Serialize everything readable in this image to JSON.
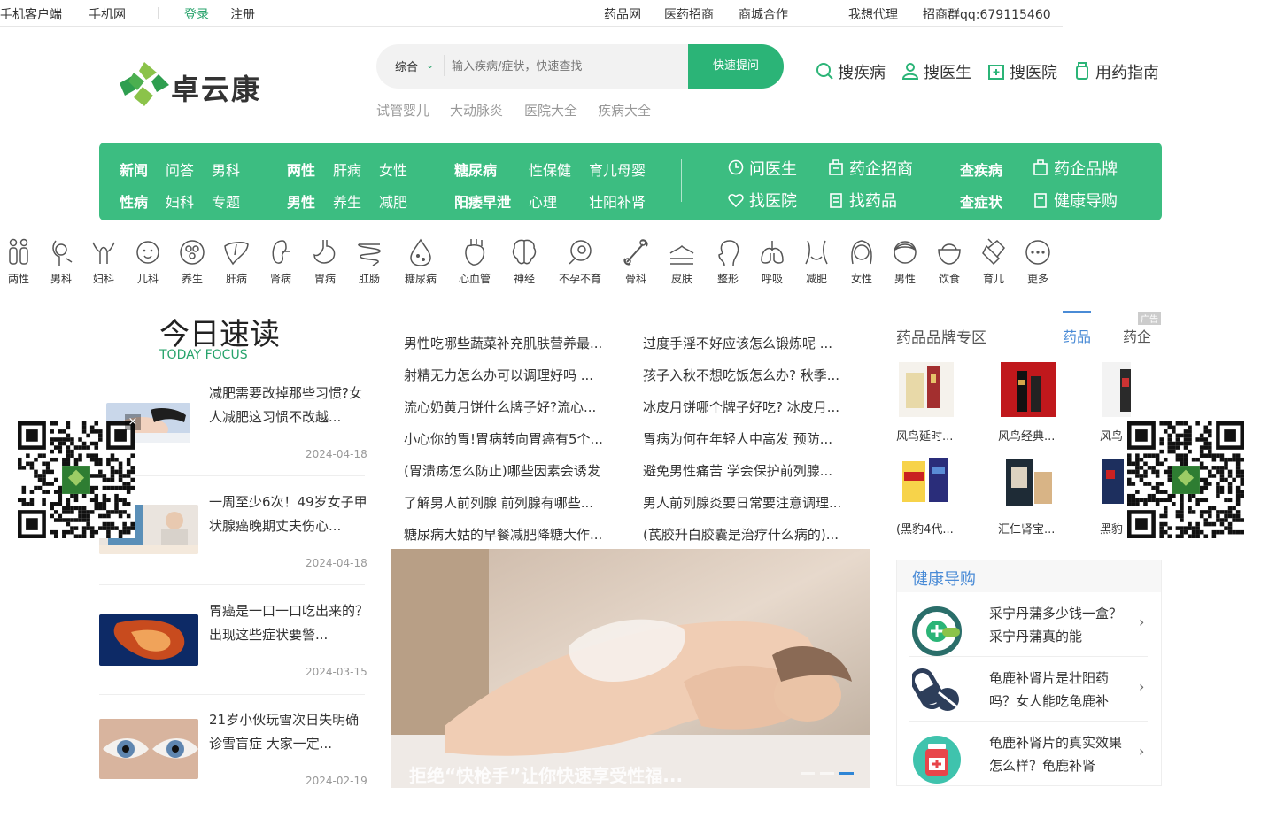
{
  "topbar": {
    "left": [
      "手机客户端",
      "手机网"
    ],
    "login": "登录",
    "register": "注册",
    "right": [
      "药品网",
      "医药招商",
      "商城合作"
    ],
    "agent": "我想代理",
    "qq": "招商群qq:679115460"
  },
  "logo": {
    "text": "卓云康",
    "colors": [
      "#8bc34a",
      "#2e9e4f"
    ]
  },
  "search": {
    "category": "综合",
    "placeholder": "输入疾病/症状，快速查找",
    "button": "快速提问",
    "hot": [
      "试管婴儿",
      "大动脉炎",
      "医院大全",
      "疾病大全"
    ]
  },
  "quick_links": [
    {
      "label": "搜疾病",
      "icon": "search-icon"
    },
    {
      "label": "搜医生",
      "icon": "user-icon"
    },
    {
      "label": "搜医院",
      "icon": "hospital-icon"
    },
    {
      "label": "用药指南",
      "icon": "medicine-bottle-icon"
    }
  ],
  "nav": {
    "row1": [
      "新闻",
      "问答",
      "男科",
      "两性",
      "肝病",
      "女性",
      "糖尿病",
      "性保健",
      "育儿母婴"
    ],
    "row2": [
      "性病",
      "妇科",
      "专题",
      "男性",
      "养生",
      "减肥",
      "阳痿早泄",
      "心理",
      "壮阳补肾"
    ],
    "services1": [
      "问医生",
      "药企招商"
    ],
    "services2": [
      "找医院",
      "找药品"
    ],
    "right1": [
      "查疾病",
      "药企品牌"
    ],
    "right2": [
      "查症状",
      "健康导购"
    ],
    "bg": "#3cbd81"
  },
  "categories": [
    "两性",
    "男科",
    "妇科",
    "儿科",
    "养生",
    "肝病",
    "肾病",
    "胃病",
    "肛肠",
    "糖尿病",
    "心血管",
    "神经",
    "不孕不育",
    "骨科",
    "皮肤",
    "整形",
    "呼吸",
    "减肥",
    "女性",
    "男性",
    "饮食",
    "育儿",
    "更多"
  ],
  "today": {
    "title": "今日速读",
    "subtitle": "TODAY FOCUS",
    "news": [
      {
        "title": "减肥需要改掉那些习惯?女人减肥这习惯不改越...",
        "date": "2024-04-18"
      },
      {
        "title": "一周至少6次！49岁女子甲状腺癌晚期丈夫伤心...",
        "date": "2024-04-18"
      },
      {
        "title": "胃癌是一口一口吃出来的？出现这些症状要警...",
        "date": "2024-03-15"
      },
      {
        "title": "21岁小伙玩雪次日失明确诊雪盲症 大家一定...",
        "date": "2024-02-19"
      }
    ]
  },
  "links": {
    "col1": [
      "男性吃哪些蔬菜补充肌肤营养最...",
      "射精无力怎么办可以调理好吗 ...",
      "流心奶黄月饼什么牌子好?流心...",
      "小心你的胃!胃病转向胃癌有5个...",
      "(胃溃疡怎么防止)哪些因素会诱发",
      "了解男人前列腺 前列腺有哪些...",
      "糖尿病大姑的早餐减肥降糖大作..."
    ],
    "col2": [
      "过度手淫不好应该怎么锻炼呢 ...",
      "孩子入秋不想吃饭怎么办? 秋季...",
      "冰皮月饼哪个牌子好吃? 冰皮月...",
      "胃病为何在年轻人中高发 预防...",
      "避免男性痛苦 学会保护前列腺...",
      "男人前列腺炎要日常要注意调理...",
      "(芪胶升白胶囊是治疗什么病的)..."
    ]
  },
  "banner": {
    "caption": "拒绝“快枪手”让你快速享受性福..."
  },
  "brand": {
    "title": "药品品牌专区",
    "tabs": [
      "药品",
      "药企"
    ],
    "ad": "广告",
    "products_row1": [
      "风鸟延时...",
      "风鸟经典...",
      "风鸟"
    ],
    "products_row2": [
      "(黑豹4代...",
      "汇仁肾宝...",
      "黑豹"
    ]
  },
  "guide": {
    "title": "健康导购",
    "items": [
      {
        "text": "采宁丹蒲多少钱一盒？采宁丹蒲真的能",
        "icon": "pill-plus-icon"
      },
      {
        "text": "龟鹿补肾片是壮阳药吗？女人能吃龟鹿补",
        "icon": "capsule-icon"
      },
      {
        "text": "龟鹿补肾片的真实效果怎么样？龟鹿补肾",
        "icon": "medicine-bottle-icon"
      }
    ]
  },
  "qr_close": "×"
}
